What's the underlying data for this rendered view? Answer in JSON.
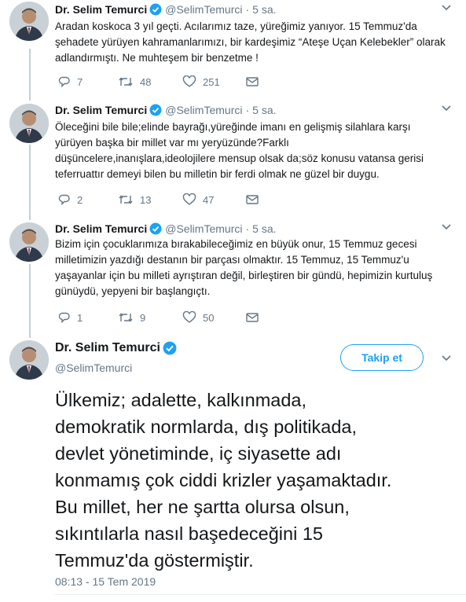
{
  "colors": {
    "blue": "#1da1f2",
    "gray": "#657786",
    "text": "#14171a",
    "line": "#c4cfd6"
  },
  "tweets": [
    {
      "name": "Dr. Selim Temurci",
      "handle": "@SelimTemurci",
      "time": "5 sa.",
      "lines": [
        "Aradan koskoca 3 yıl geçti. Acılarımız taze, yüreğimiz yanıyor. 15 Temmuz'da",
        "şehadete yürüyen kahramanlarımızı, bir kardeşimiz “Ateşe Uçan Kelebekler” olarak",
        "adlandırmıştı. Ne muhteşem bir benzetme !"
      ],
      "replies": "7",
      "retweets": "48",
      "likes": "251"
    },
    {
      "name": "Dr. Selim Temurci",
      "handle": "@SelimTemurci",
      "time": "5 sa.",
      "lines": [
        "Öleceğini bile bile;elinde bayrağı,yüreğinde imanı en gelişmiş silahlara karşı",
        "yürüyen başka bir millet var mı yeryüzünde?Farklı",
        "düşüncelere,inanışlara,ideolojilere mensup olsak da;söz konusu vatansa gerisi",
        "teferruattır demeyi bilen bu milletin bir ferdi olmak ne güzel bir duygu."
      ],
      "replies": "2",
      "retweets": "13",
      "likes": "47"
    },
    {
      "name": "Dr. Selim Temurci",
      "handle": "@SelimTemurci",
      "time": "5 sa.",
      "lines": [
        "Bizim için çocuklarımıza bırakabileceğimiz en büyük onur, 15 Temmuz gecesi",
        "milletimizin yazdığı destanın bir parçası olmaktır. 15 Temmuz, 15 Temmuz'u",
        "yaşayanlar için bu milleti ayrıştıran değil, birleştiren bir gündü, hepimizin kurtuluş",
        "günüydü, yepyeni bir başlangıçtı."
      ],
      "replies": "1",
      "retweets": "9",
      "likes": "50"
    }
  ],
  "main": {
    "name": "Dr. Selim Temurci",
    "handle": "@SelimTemurci",
    "follow_label": "Takip et",
    "lines": [
      "Ülkemiz; adalette, kalkınmada,",
      "demokratik normlarda, dış politikada,",
      "devlet yönetiminde, iç siyasette adı",
      "konmamış çok ciddi krizler yaşamaktadır.",
      "Bu millet, her ne şartta olursa olsun,",
      "sıkıntılarla nasıl başedeceğini 15",
      "Temmuz'da göstermiştir."
    ],
    "timestamp": "08:13 - 15 Tem 2019"
  }
}
